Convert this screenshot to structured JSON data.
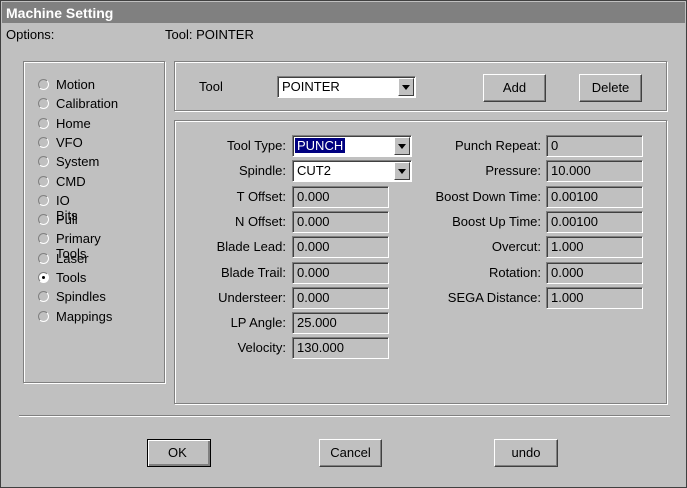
{
  "window": {
    "title": "Machine Setting"
  },
  "options": {
    "label": "Options:",
    "items": [
      {
        "label": "Motion",
        "checked": false
      },
      {
        "label": "Calibration",
        "checked": false
      },
      {
        "label": "Home",
        "checked": false
      },
      {
        "label": "VFO",
        "checked": false
      },
      {
        "label": "System",
        "checked": false
      },
      {
        "label": "CMD",
        "checked": false
      },
      {
        "label": "IO Bits",
        "checked": false
      },
      {
        "label": "Pull",
        "checked": false
      },
      {
        "label": "Primary Tools",
        "checked": false
      },
      {
        "label": "Laser",
        "checked": false
      },
      {
        "label": "Tools",
        "checked": true
      },
      {
        "label": "Spindles",
        "checked": false
      },
      {
        "label": "Mappings",
        "checked": false
      }
    ]
  },
  "tool_header": {
    "caption": "Tool:  POINTER"
  },
  "tool_select": {
    "label": "Tool",
    "value": "POINTER",
    "add_label": "Add",
    "delete_label": "Delete"
  },
  "params_left": [
    {
      "label": "Tool Type:",
      "value": "PUNCH",
      "kind": "select"
    },
    {
      "label": "Spindle:",
      "value": "CUT2",
      "kind": "select"
    },
    {
      "label": "T Offset:",
      "value": "0.000",
      "kind": "text"
    },
    {
      "label": "N Offset:",
      "value": "0.000",
      "kind": "text"
    },
    {
      "label": "Blade Lead:",
      "value": "0.000",
      "kind": "text"
    },
    {
      "label": "Blade Trail:",
      "value": "0.000",
      "kind": "text"
    },
    {
      "label": "Understeer:",
      "value": "0.000",
      "kind": "text"
    },
    {
      "label": "LP Angle:",
      "value": "25.000",
      "kind": "text"
    },
    {
      "label": "Velocity:",
      "value": "130.000",
      "kind": "text"
    }
  ],
  "params_right": [
    {
      "label": "Punch Repeat:",
      "value": "0"
    },
    {
      "label": "Pressure:",
      "value": "10.000"
    },
    {
      "label": "Boost Down Time:",
      "value": "0.00100"
    },
    {
      "label": "Boost Up Time:",
      "value": "0.00100"
    },
    {
      "label": "Overcut:",
      "value": "1.000"
    },
    {
      "label": "Rotation:",
      "value": "0.000"
    },
    {
      "label": "SEGA Distance:",
      "value": "1.000"
    }
  ],
  "footer": {
    "ok_label": "OK",
    "cancel_label": "Cancel",
    "undo_label": "undo"
  }
}
